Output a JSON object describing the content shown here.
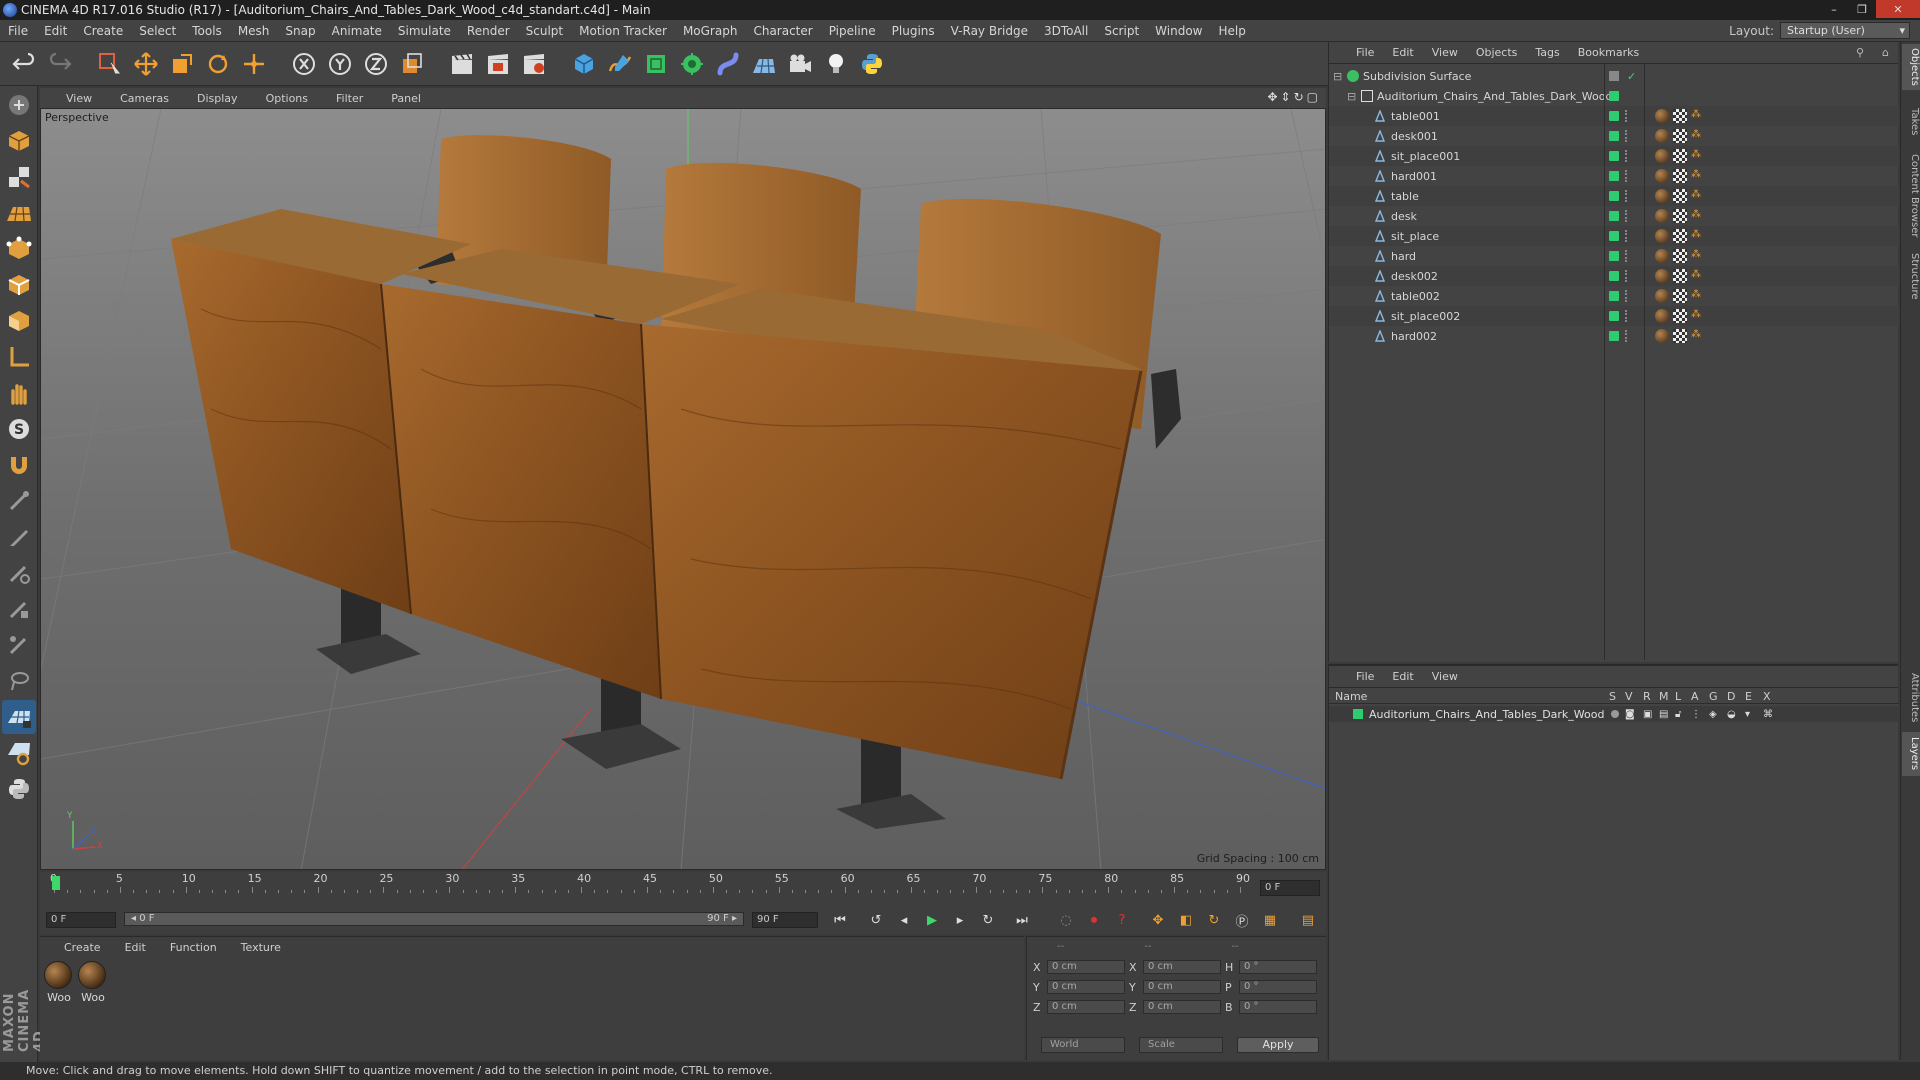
{
  "window": {
    "title": "CINEMA 4D R17.016 Studio (R17) - [Auditorium_Chairs_And_Tables_Dark_Wood_c4d_standart.c4d] - Main",
    "controls": [
      "–",
      "❐",
      "✕"
    ]
  },
  "menubar": {
    "items": [
      "File",
      "Edit",
      "Create",
      "Select",
      "Tools",
      "Mesh",
      "Snap",
      "Animate",
      "Simulate",
      "Render",
      "Sculpt",
      "Motion Tracker",
      "MoGraph",
      "Character",
      "Pipeline",
      "Plugins",
      "V-Ray Bridge",
      "3DToAll",
      "Script",
      "Window",
      "Help"
    ],
    "layout_label": "Layout:",
    "layout_value": "Startup (User)"
  },
  "viewport": {
    "menu": [
      "View",
      "Cameras",
      "Display",
      "Options",
      "Filter",
      "Panel"
    ],
    "camera_label": "Perspective",
    "grid_spacing": "Grid Spacing : 100 cm",
    "axis_labels": {
      "y": "Y",
      "x": "X",
      "z": "Z"
    }
  },
  "timeline": {
    "ticks": [
      "0",
      "5",
      "10",
      "15",
      "20",
      "25",
      "30",
      "35",
      "40",
      "45",
      "50",
      "55",
      "60",
      "65",
      "70",
      "75",
      "80",
      "85",
      "90"
    ],
    "current_frame": "0 F",
    "start_frame": "0 F",
    "range_start": "◂ 0 F",
    "range_end": "90 F ▸",
    "end_frame": "90 F"
  },
  "materials": {
    "menu": [
      "Create",
      "Edit",
      "Function",
      "Texture"
    ],
    "items": [
      {
        "label": "Woo"
      },
      {
        "label": "Woo"
      }
    ]
  },
  "coordinates": {
    "headers": [
      "--",
      "--",
      "--"
    ],
    "rows": [
      {
        "a1": "X",
        "v1": "0 cm",
        "a2": "X",
        "v2": "0 cm",
        "a3": "H",
        "v3": "0 °"
      },
      {
        "a1": "Y",
        "v1": "0 cm",
        "a2": "Y",
        "v2": "0 cm",
        "a3": "P",
        "v3": "0 °"
      },
      {
        "a1": "Z",
        "v1": "0 cm",
        "a2": "Z",
        "v2": "0 cm",
        "a3": "B",
        "v3": "0 °"
      }
    ],
    "space": "World",
    "mode": "Scale",
    "apply": "Apply"
  },
  "status": "Move: Click and drag to move elements. Hold down SHIFT to quantize movement / add to the selection in point mode, CTRL to remove.",
  "object_manager": {
    "menu": [
      "File",
      "Edit",
      "View",
      "Objects",
      "Tags",
      "Bookmarks"
    ],
    "root": "Subdivision Surface",
    "group": "Auditorium_Chairs_And_Tables_Dark_Wood",
    "children": [
      "table001",
      "desk001",
      "sit_place001",
      "hard001",
      "table",
      "desk",
      "sit_place",
      "hard",
      "desk002",
      "table002",
      "sit_place002",
      "hard002"
    ]
  },
  "layer_manager": {
    "menu": [
      "File",
      "Edit",
      "View"
    ],
    "columns": [
      "Name",
      "S",
      "V",
      "R",
      "M",
      "L",
      "A",
      "G",
      "D",
      "E",
      "X"
    ],
    "row": "Auditorium_Chairs_And_Tables_Dark_Wood"
  },
  "side_tabs": [
    "Objects",
    "Takes",
    "Content Browser",
    "Structure",
    "Attributes",
    "Layers"
  ],
  "branding": "MAXON CINEMA 4D",
  "colors": {
    "accent": "#2f5e8a",
    "layer_green": "#2ecc71",
    "playhead": "#3fd66a"
  }
}
